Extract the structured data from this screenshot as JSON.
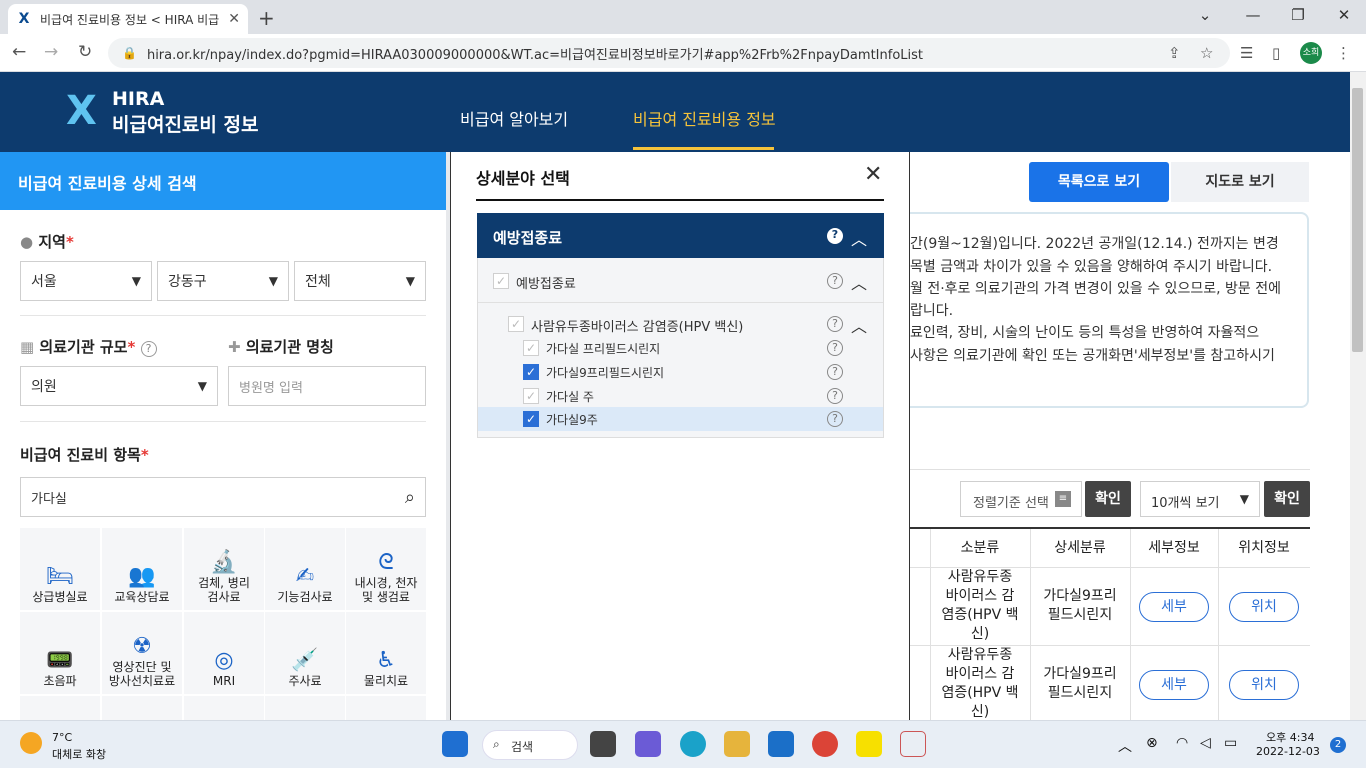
{
  "browser": {
    "tab_title": "비급여 진료비용 정보 < HIRA 비급",
    "tab_close": "✕",
    "new_tab": "+",
    "url": "hira.or.kr/npay/index.do?pgmid=HIRAA030009000000&WT.ac=비급여진료비정보바로가기#app%2Frb%2FnpayDamtInfoList",
    "profile_initials": "소희"
  },
  "site": {
    "logo_line1": "HIRA",
    "logo_line2": "비급여진료비 정보",
    "nav": [
      "비급여 알아보기",
      "비급여 진료비용 정보"
    ]
  },
  "left_panel": {
    "title": "비급여 진료비용 상세 검색",
    "region_label": "지역",
    "region": [
      "서울",
      "강동구",
      "전체"
    ],
    "scale_label": "의료기관 규모",
    "scale_value": "의원",
    "name_label": "의료기관 명칭",
    "name_placeholder": "병원명 입력",
    "item_label": "비급여 진료비 항목",
    "item_value": "가다실",
    "categories": [
      "상급병실료",
      "교육상담료",
      "검체, 병리\n검사료",
      "기능검사료",
      "내시경, 천자\n및 생검료",
      "초음파",
      "영상진단 및\n방사선치료료",
      "MRI",
      "주사료",
      "물리치료"
    ],
    "required_mark": "*"
  },
  "modal": {
    "title": "상세분야 선택",
    "close": "✕",
    "category": "예방접종료",
    "tree": [
      {
        "label": "예방접종료",
        "checked": false,
        "level": 0
      },
      {
        "label": "사람유두종바이러스 감염증(HPV 백신)",
        "checked": false,
        "level": 1
      },
      {
        "label": "가다실 프리필드시린지",
        "checked": false,
        "level": 2
      },
      {
        "label": "가다실9프리필드시린지",
        "checked": true,
        "level": 2
      },
      {
        "label": "가다실 주",
        "checked": false,
        "level": 2
      },
      {
        "label": "가다실9주",
        "checked": true,
        "level": 2
      }
    ]
  },
  "right": {
    "list_view": "목록으로 보기",
    "map_view": "지도로 보기",
    "notice_lines": [
      "간(9월~12월)입니다. 2022년 공개일(12.14.) 전까지는 변경",
      "목별 금액과 차이가 있을 수 있음을 양해하여 주시기 바랍니다.",
      "월 전·후로 의료기관의 가격 변경이 있을 수 있으므로, 방문 전에",
      "랍니다.",
      "료인력, 장비, 시술의 난이도 등의 특성을 반영하여 자율적으",
      "사항은 의료기관에 확인 또는 공개화면'세부정보'를 참고하시기"
    ],
    "sort_label": "정렬기준 선택",
    "confirm": "확인",
    "per_page": "10개씩 보기",
    "columns": [
      "소분류",
      "상세분류",
      "세부정보",
      "위치정보"
    ],
    "rows": [
      {
        "sub": "사람유두종\n바이러스 감\n염증(HPV 백\n신)",
        "detail": "가다실9프리\n필드시린지",
        "info": "세부",
        "loc": "위치"
      },
      {
        "sub": "사람유두종\n바이러스 감\n염증(HPV 백\n신)",
        "detail": "가다실9프리\n필드시린지",
        "info": "세부",
        "loc": "위치"
      }
    ]
  },
  "taskbar": {
    "temp": "7°C",
    "weather": "대체로 화창",
    "search": "검색",
    "time": "오후 4:34",
    "date": "2022-12-03",
    "notifications": "2"
  }
}
